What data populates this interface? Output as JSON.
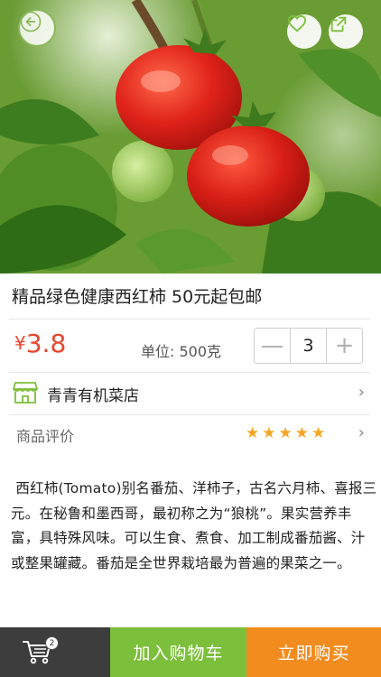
{
  "product": {
    "title": "精品绿色健康西红柿 50元起包邮",
    "currency_symbol": "¥",
    "price": "3.8",
    "unit_text": "单位: 500克",
    "quantity": "3",
    "minus_symbol": "—",
    "plus_symbol": "+"
  },
  "shop": {
    "name": "青青有机菜店",
    "icon": "storefront-icon",
    "chevron": "›"
  },
  "reviews": {
    "label": "商品评价",
    "rating": 5,
    "star_glyph": "★",
    "chevron": "›"
  },
  "description": "西红柿(Tomato)别名番茄、洋柿子，古名六月柿、喜报三元。在秘鲁和墨西哥，最初称之为“狼桃”。果实营养丰富，具特殊风味。可以生食、煮食、加工制成番茄酱、汁或整果罐藏。番茄是全世界栽培最为普遍的果菜之一。",
  "bottom_bar": {
    "cart_badge": "2",
    "add_to_cart": "加入购物车",
    "buy_now": "立即购买"
  },
  "colors": {
    "price": "#e8452c",
    "green_accent": "#7cbf3a",
    "orange_accent": "#f28c1f",
    "dark_bar": "#3d3d3d",
    "star": "#f5a623"
  }
}
